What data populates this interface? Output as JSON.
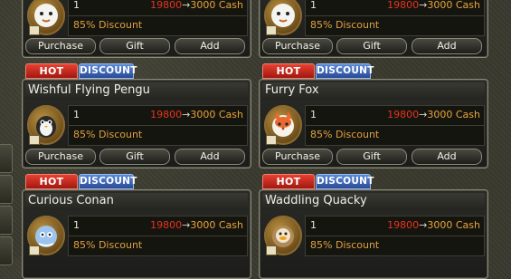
{
  "labels": {
    "hot": "HOT",
    "discount": "DISCOUNT",
    "purchase": "Purchase",
    "gift": "Gift",
    "add": "Add"
  },
  "items": [
    {
      "name": "",
      "qty": "1",
      "old_price": "19800",
      "arrow": "→",
      "new_price": "3000 Cash",
      "discount": "85% Discount",
      "icon": "penguin-icon"
    },
    {
      "name": "",
      "qty": "1",
      "old_price": "19800",
      "arrow": "→",
      "new_price": "3000 Cash",
      "discount": "85% Discount",
      "icon": "penguin-icon"
    },
    {
      "name": "Wishful Flying Pengu",
      "qty": "1",
      "old_price": "19800",
      "arrow": "→",
      "new_price": "3000 Cash",
      "discount": "85% Discount",
      "icon": "penguin-icon"
    },
    {
      "name": "Furry Fox",
      "qty": "1",
      "old_price": "19800",
      "arrow": "→",
      "new_price": "3000 Cash",
      "discount": "85% Discount",
      "icon": "fox-icon"
    },
    {
      "name": "Curious Conan",
      "qty": "1",
      "old_price": "19800",
      "arrow": "→",
      "new_price": "3000 Cash",
      "discount": "85% Discount",
      "icon": "blue-pet-icon"
    },
    {
      "name": "Waddling Quacky",
      "qty": "1",
      "old_price": "19800",
      "arrow": "→",
      "new_price": "3000 Cash",
      "discount": "85% Discount",
      "icon": "duck-icon"
    }
  ],
  "colors": {
    "old_price": "#e8331f",
    "new_price": "#e8a43a",
    "discount_text": "#e0a040",
    "hot_badge": "#d02818",
    "discount_badge": "#3a64c0"
  }
}
